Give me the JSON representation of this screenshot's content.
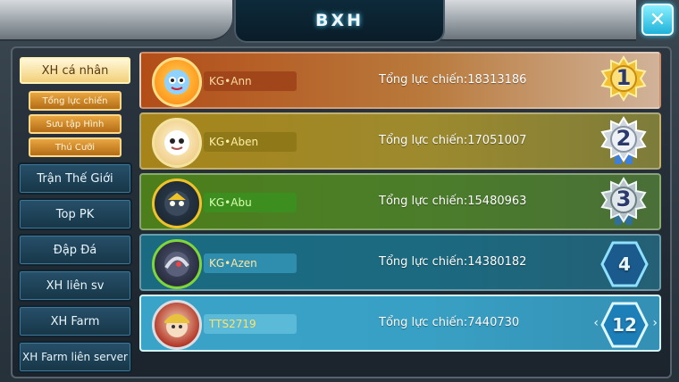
{
  "header": {
    "title": "BXH",
    "close_label": "✕"
  },
  "sidebar": {
    "active": "XH cá nhân",
    "sub_items": [
      "Tổng lực chiến",
      "Sưu tập Hình",
      "Thú Cưỡi"
    ],
    "items": [
      "Trận Thế Giới",
      "Top PK",
      "Đập Đá",
      "XH liên sv",
      "XH Farm",
      "XH Farm liên server"
    ]
  },
  "rankings": [
    {
      "rank": "1",
      "name": "KG•Ann",
      "power": "Tổng lực chiến:18313186",
      "medal": "gold"
    },
    {
      "rank": "2",
      "name": "KG•Aben",
      "power": "Tổng lực chiến:17051007",
      "medal": "silver"
    },
    {
      "rank": "3",
      "name": "KG•Abu",
      "power": "Tổng lực chiến:15480963",
      "medal": "bronze"
    },
    {
      "rank": "4",
      "name": "KG•Azen",
      "power": "Tổng lực chiến:14380182",
      "medal": "hex"
    },
    {
      "rank": "12",
      "name": "TTS2719",
      "power": "Tổng lực chiến:7440730",
      "medal": "hex-self"
    }
  ],
  "icons": {
    "close": "close-icon",
    "medal": "rank-medal-icon",
    "hex": "rank-hex-icon",
    "avatar": "pet-avatar-icon"
  }
}
